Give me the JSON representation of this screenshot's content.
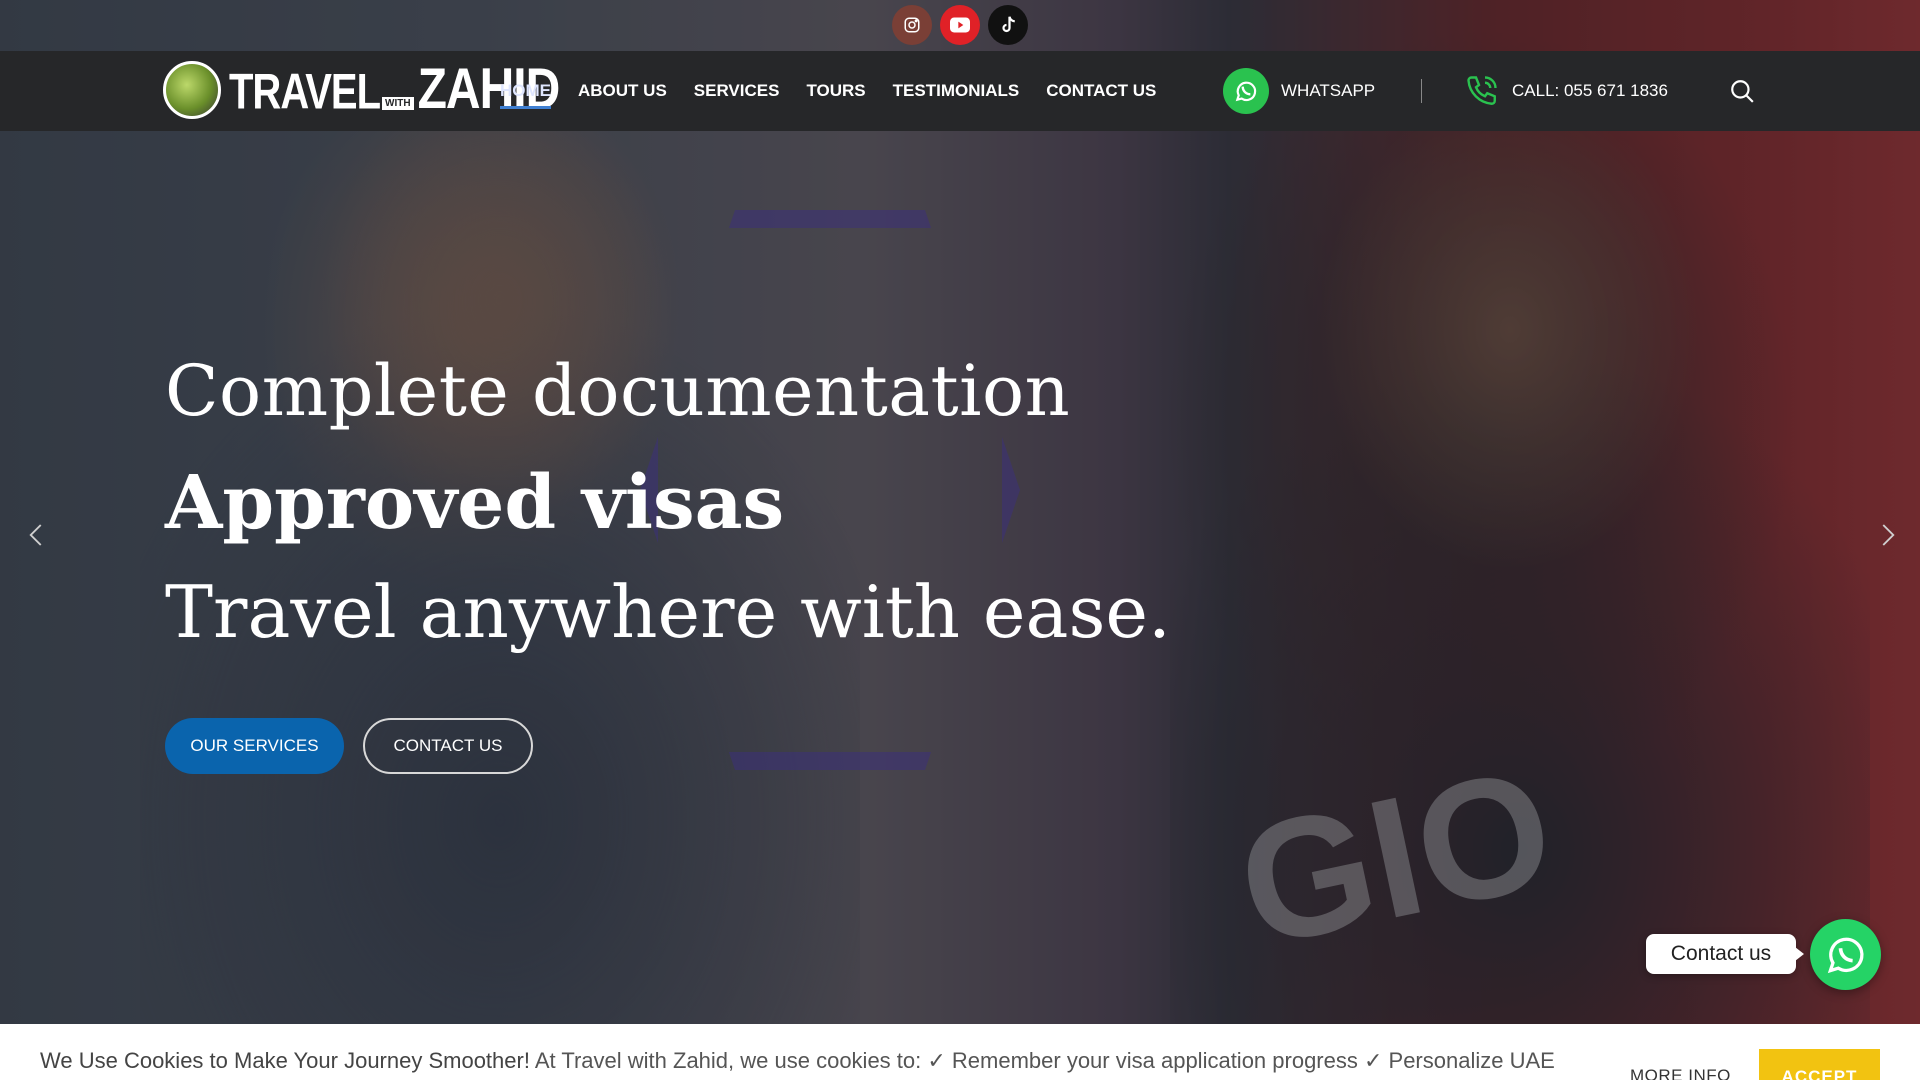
{
  "social": {
    "items": [
      {
        "name": "instagram",
        "icon": "instagram-icon",
        "color": "#7a3f36"
      },
      {
        "name": "youtube",
        "icon": "youtube-icon",
        "color": "#e02127"
      },
      {
        "name": "tiktok",
        "icon": "tiktok-icon",
        "color": "#111111"
      }
    ]
  },
  "header": {
    "logo": {
      "travel": "TRAVEL",
      "with": "WITH",
      "zahid": "ZAHID"
    },
    "nav": [
      {
        "label": "HOME",
        "active": true
      },
      {
        "label": "ABOUT US"
      },
      {
        "label": "SERVICES"
      },
      {
        "label": "TOURS"
      },
      {
        "label": "TESTIMONIALS"
      },
      {
        "label": "CONTACT US"
      }
    ],
    "whatsapp_label": "WHATSAPP",
    "call_label": "CALL: 055 671 1836",
    "accent": "#3f7fd1"
  },
  "hero": {
    "line1": "Complete documentation",
    "line2": "Approved visas",
    "line3": "Travel anywhere with ease.",
    "primary_button": "OUR SERVICES",
    "secondary_button": "CONTACT US",
    "primary_color": "#0a64ad"
  },
  "widget": {
    "contact_label": "Contact us",
    "whatsapp_color": "#25d366"
  },
  "cookie": {
    "lead": "We Use Cookies to Make Your Journey Smoother!",
    "text": " At Travel with Zahid, we use cookies to: ✓ Remember your visa application progress ✓ Personalize UAE",
    "more_info": "MORE INFO",
    "accept": "ACCEPT",
    "accept_color": "#f2c311"
  }
}
